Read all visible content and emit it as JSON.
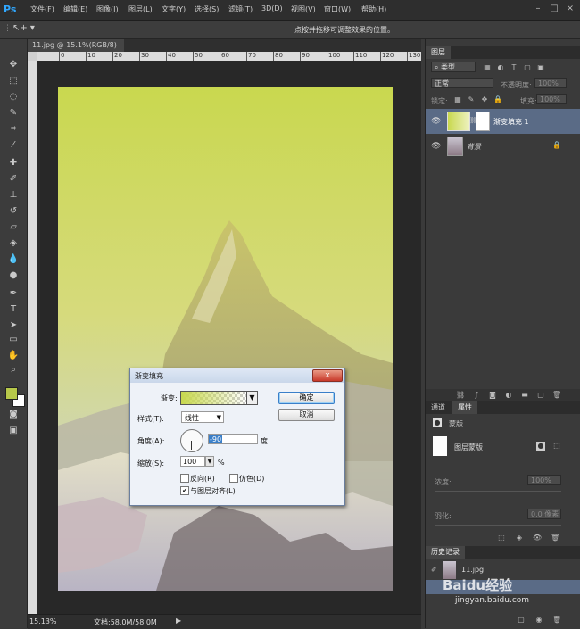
{
  "menubar": {
    "logo": "Ps",
    "items": [
      "文件(F)",
      "编辑(E)",
      "图像(I)",
      "图层(L)",
      "文字(Y)",
      "选择(S)",
      "滤镜(T)",
      "3D(D)",
      "视图(V)",
      "窗口(W)",
      "帮助(H)"
    ]
  },
  "optionsbar": {
    "hint": "点按并拖移可调整效果的位置。"
  },
  "document": {
    "tab_label": "11.jpg @ 15.1%(RGB/8)",
    "tab_close": "×",
    "ruler_ticks": [
      "0",
      "10",
      "20",
      "30",
      "40",
      "50",
      "60",
      "70",
      "80",
      "90",
      "100",
      "110",
      "120",
      "130"
    ]
  },
  "status": {
    "zoom": "15.13%",
    "doc_size": "文档:58.0M/58.0M"
  },
  "layers_panel": {
    "tab": "图层",
    "kind_filter": "类型",
    "blend_mode": "正常",
    "opacity_label": "不透明度:",
    "opacity_value": "100%",
    "lock_label": "锁定:",
    "fill_label": "填充:",
    "fill_value": "100%",
    "layers": [
      {
        "name": "渐变填充 1"
      },
      {
        "name": "背景"
      }
    ]
  },
  "properties_panel": {
    "tabs": [
      "通道",
      "属性"
    ],
    "mask_label": "蒙版",
    "layer_mask_label": "图层蒙版",
    "density_label": "浓度:",
    "density_value": "100%",
    "feather_label": "羽化:",
    "feather_value": "0.0 像素"
  },
  "history_panel": {
    "tab": "历史记录",
    "snapshot_label": "11.jpg"
  },
  "dialog": {
    "title": "渐变填充",
    "close": "x",
    "gradient_label": "渐变:",
    "style_label": "样式(T):",
    "style_value": "线性",
    "angle_label": "角度(A):",
    "angle_value": "-90",
    "angle_unit": "度",
    "scale_label": "缩放(S):",
    "scale_value": "100",
    "scale_unit": "%",
    "reverse_label": "反向(R)",
    "dither_label": "仿色(D)",
    "align_label": "与图层对齐(L)",
    "ok_label": "确定",
    "cancel_label": "取消",
    "reverse_checked": false,
    "dither_checked": false,
    "align_checked": true
  },
  "watermark": {
    "brand": "Baidu经验",
    "url": "jingyan.baidu.com"
  },
  "colors": {
    "foreground": "#b7c84a",
    "background": "#ffffff",
    "gradient_start": "#c8d84e",
    "accent_blue": "#3a7fc9"
  }
}
